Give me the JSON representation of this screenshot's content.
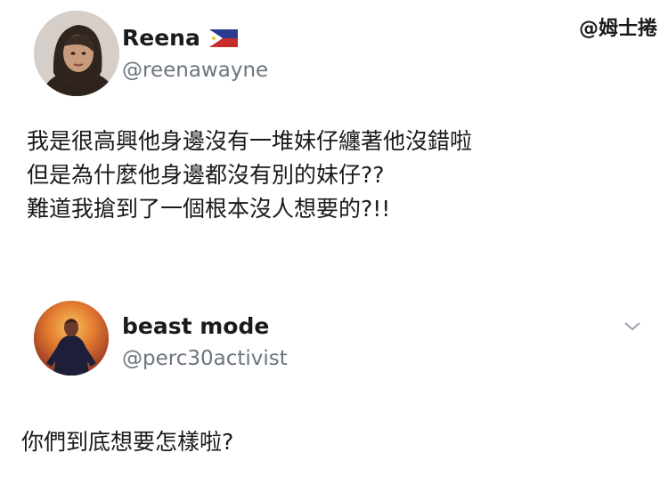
{
  "watermark": "@姆士捲",
  "tweets": [
    {
      "author": {
        "name": "Reena",
        "handle": "@reenawayne",
        "flag": "philippines-flag-icon"
      },
      "text": "我是很高興他身邊沒有一堆妹仔纏著他沒錯啦\n但是為什麼他身邊都沒有別的妹仔??\n難道我搶到了一個根本沒人想要的?!!"
    },
    {
      "author": {
        "name": "beast mode",
        "handle": "@perc30activist"
      },
      "text": "你們到底想要怎樣啦?",
      "menu_icon": "chevron-down-icon"
    }
  ]
}
